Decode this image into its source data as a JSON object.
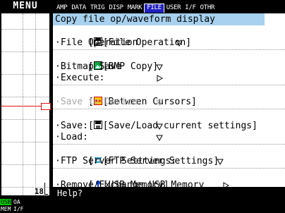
{
  "left_panel": {
    "menu_label": "MENU",
    "channel_number": "18",
    "status": {
      "usb": "USB",
      "oa": "OA",
      "mem": "MEM",
      "if": "I/F"
    }
  },
  "tabs": [
    {
      "label": "AMP"
    },
    {
      "label": "DATA"
    },
    {
      "label": "TRIG"
    },
    {
      "label": "DISP"
    },
    {
      "label": "MARK"
    },
    {
      "label": "FILE",
      "active": true
    },
    {
      "label": "USER"
    },
    {
      "label": "I/F"
    },
    {
      "label": "OTHR"
    }
  ],
  "panel": {
    "title": "Copy file op/waveform display",
    "sections": [
      {
        "header": "[File Operation]",
        "icon": "floppy-icon",
        "items": [
          {
            "label": "·File Operation",
            "control": "dropdown"
          }
        ]
      },
      {
        "header": "[BMP Copy]",
        "icon": "bmp-icon",
        "items": [
          {
            "label": "·Bitmap Save",
            "control": "dropdown"
          },
          {
            "label": "·Execute:",
            "control": "play"
          }
        ]
      },
      {
        "header": "[Between Cursors]",
        "icon": "cursor-icon",
        "items": [
          {
            "label": "·Save to Device",
            "control": "dropdown",
            "disabled": true
          }
        ]
      },
      {
        "header": "[Save/Load current settings]",
        "icon": "floppy-icon",
        "items": [
          {
            "label": "·Save:",
            "control": "dropdown"
          },
          {
            "label": "·Load:",
            "control": "dropdown"
          }
        ]
      },
      {
        "header": "[FTP Server Settings]",
        "icon": "network-icon",
        "items": [
          {
            "label": "·FTP Server Setttings:",
            "control": "dropdown"
          }
        ]
      },
      {
        "header": "[USB Memory]",
        "icon": "usb-icon",
        "items": [
          {
            "label": "·Remove/Exchange USB Memory",
            "control": "play"
          }
        ]
      }
    ]
  },
  "help": {
    "text": "Help?"
  },
  "colors": {
    "title_bg": "#a7d1ee",
    "active_tab_bg": "#2020c0",
    "ref_line": "#e01010"
  }
}
